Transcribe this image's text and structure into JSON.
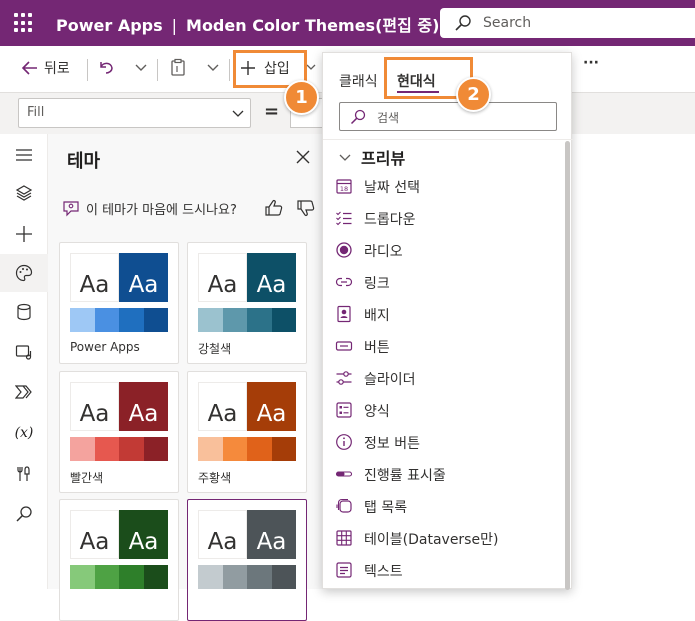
{
  "titlebar": {
    "app_name": "Power Apps",
    "separator": "|",
    "document_title": "Moden Color Themes(편집 중)",
    "search_placeholder": "Search"
  },
  "command_bar": {
    "back_label": "뒤로",
    "insert_label": "삽입",
    "more_label": "···"
  },
  "formula_bar": {
    "property_value": "Fill",
    "equals": "="
  },
  "left_rail": {
    "items": [
      "hamburger-icon",
      "layers-icon",
      "plus-icon",
      "palette-icon",
      "database-icon",
      "media-icon",
      "power-automate-icon",
      "variables-icon",
      "tools-icon",
      "search-icon"
    ],
    "variables_label": "(x)"
  },
  "theme_pane": {
    "title": "테마",
    "feedback_text": "이 테마가 마음에 드시나요?",
    "cards": [
      {
        "name": "Power Apps",
        "light": "Aa",
        "dark": "Aa",
        "dark_color": "#0f4e91",
        "strip": [
          "#9ec8f5",
          "#4a90e2",
          "#1f6fbf",
          "#0f4e91"
        ]
      },
      {
        "name": "강철색",
        "light": "Aa",
        "dark": "Aa",
        "dark_color": "#0d5067",
        "strip": [
          "#9bc2cf",
          "#5e98ab",
          "#2c7289",
          "#0d5067"
        ]
      },
      {
        "name": "빨간색",
        "light": "Aa",
        "dark": "Aa",
        "dark_color": "#8b2127",
        "strip": [
          "#f4a39e",
          "#e6584f",
          "#c23a35",
          "#8b2127"
        ]
      },
      {
        "name": "주황색",
        "light": "Aa",
        "dark": "Aa",
        "dark_color": "#a53d08",
        "strip": [
          "#f9c09b",
          "#f58a3c",
          "#e0621a",
          "#a53d08"
        ]
      },
      {
        "name": "",
        "light": "Aa",
        "dark": "Aa",
        "dark_color": "#1b4d1b",
        "strip": [
          "#86c97a",
          "#4ea244",
          "#2e7f2a",
          "#1b4d1b"
        ]
      },
      {
        "name": "",
        "light": "Aa",
        "dark": "Aa",
        "dark_color": "#4d5458",
        "strip": [
          "#c3cbcf",
          "#919ca1",
          "#6c777c",
          "#4d5458"
        ]
      }
    ]
  },
  "insert_flyout": {
    "tabs": [
      {
        "label": "클래식",
        "active": false
      },
      {
        "label": "현대식",
        "active": true
      }
    ],
    "search_placeholder": "검색",
    "section_title": "프리뷰",
    "items": [
      {
        "label": "날짜 선택",
        "icon": "calendar-icon"
      },
      {
        "label": "드롭다운",
        "icon": "list-check-icon"
      },
      {
        "label": "라디오",
        "icon": "radio-icon"
      },
      {
        "label": "링크",
        "icon": "link-icon"
      },
      {
        "label": "배지",
        "icon": "badge-icon"
      },
      {
        "label": "버튼",
        "icon": "button-icon"
      },
      {
        "label": "슬라이더",
        "icon": "slider-icon"
      },
      {
        "label": "양식",
        "icon": "form-icon"
      },
      {
        "label": "정보 버튼",
        "icon": "info-icon"
      },
      {
        "label": "진행률 표시줄",
        "icon": "progress-icon"
      },
      {
        "label": "탭 목록",
        "icon": "tab-list-icon"
      },
      {
        "label": "테이블(Dataverse만)",
        "icon": "table-icon"
      },
      {
        "label": "텍스트",
        "icon": "text-icon"
      }
    ]
  },
  "callouts": [
    {
      "number": "1"
    },
    {
      "number": "2"
    }
  ],
  "colors": {
    "brand": "#742774",
    "highlight": "#f08a36"
  }
}
